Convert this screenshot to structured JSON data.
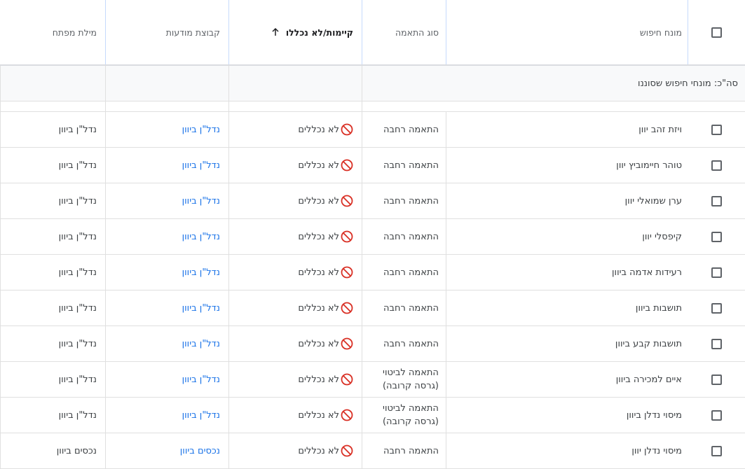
{
  "header": {
    "term_label": "מונח חיפוש",
    "match_label": "סוג התאמה",
    "status_label": "קיימות/לא נכללו",
    "group_label": "קבוצת מודעות",
    "keyword_label": "מילת מפתח"
  },
  "total_row": {
    "label": "סה\"כ: מונחי חיפוש שסוננו"
  },
  "icons": {
    "ban": "ban-icon",
    "sort": "arrow-up-icon",
    "ban_color": "#d93025",
    "link_color": "#1a73e8"
  },
  "rows": [
    {
      "term": "ויזת זהב יוון",
      "match": "התאמה רחבה",
      "status": "לא נכללים",
      "group": "נדל\"ן ביוון",
      "keyword": "נדל\"ן ביוון"
    },
    {
      "term": "טוהר חיימוביץ יוון",
      "match": "התאמה רחבה",
      "status": "לא נכללים",
      "group": "נדל\"ן ביוון",
      "keyword": "נדל\"ן ביוון"
    },
    {
      "term": "ערן שמואלי יוון",
      "match": "התאמה רחבה",
      "status": "לא נכללים",
      "group": "נדל\"ן ביוון",
      "keyword": "נדל\"ן ביוון"
    },
    {
      "term": "קיפסלי יוון",
      "match": "התאמה רחבה",
      "status": "לא נכללים",
      "group": "נדל\"ן ביוון",
      "keyword": "נדל\"ן ביוון"
    },
    {
      "term": "רעידות אדמה ביוון",
      "match": "התאמה רחבה",
      "status": "לא נכללים",
      "group": "נדל\"ן ביוון",
      "keyword": "נדל\"ן ביוון"
    },
    {
      "term": "תושבות ביוון",
      "match": "התאמה רחבה",
      "status": "לא נכללים",
      "group": "נדל\"ן ביוון",
      "keyword": "נדל\"ן ביוון"
    },
    {
      "term": "תושבות קבע ביוון",
      "match": "התאמה רחבה",
      "status": "לא נכללים",
      "group": "נדל\"ן ביוון",
      "keyword": "נדל\"ן ביוון"
    },
    {
      "term": "איים למכירה ביוון",
      "match": "התאמה לביטוי",
      "match2": "(גרסה קרובה)",
      "status": "לא נכללים",
      "group": "נדל\"ן ביוון",
      "keyword": "נדל\"ן ביוון"
    },
    {
      "term": "מיסוי נדלן ביוון",
      "match": "התאמה לביטוי",
      "match2": "(גרסה קרובה)",
      "status": "לא נכללים",
      "group": "נדל\"ן ביוון",
      "keyword": "נדל\"ן ביוון"
    },
    {
      "term": "מיסוי נדלן יוון",
      "match": "התאמה רחבה",
      "status": "לא נכללים",
      "group": "נכסים ביוון",
      "keyword": "נכסים ביוון"
    }
  ]
}
